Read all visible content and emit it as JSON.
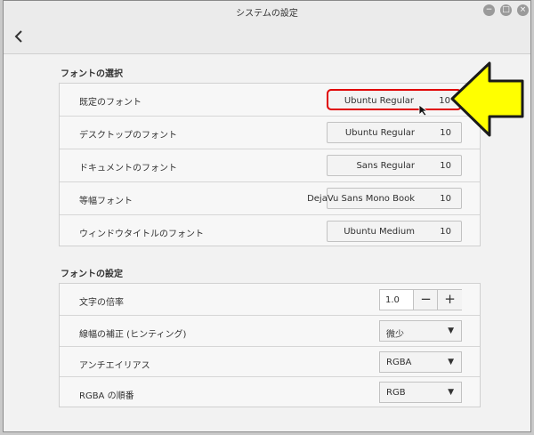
{
  "window": {
    "title": "システムの設定"
  },
  "titlebar_buttons": {
    "minimize": "−",
    "maximize": "□",
    "close": "×"
  },
  "header": {
    "back_icon": "‹"
  },
  "font_selection": {
    "heading": "フォントの選択",
    "rows": [
      {
        "label": "既定のフォント",
        "font": "Ubuntu Regular",
        "size": "10"
      },
      {
        "label": "デスクトップのフォント",
        "font": "Ubuntu Regular",
        "size": "10"
      },
      {
        "label": "ドキュメントのフォント",
        "font": "Sans Regular",
        "size": "10"
      },
      {
        "label": "等幅フォント",
        "font": "DejaVu Sans Mono Book",
        "size": "10"
      },
      {
        "label": "ウィンドウタイトルのフォント",
        "font": "Ubuntu Medium",
        "size": "10"
      }
    ]
  },
  "font_settings": {
    "heading": "フォントの設定",
    "scale": {
      "label": "文字の倍率",
      "value": "1.0",
      "minus": "−",
      "plus": "+"
    },
    "hinting": {
      "label": "線幅の補正 (ヒンティング)",
      "value": "微少"
    },
    "antialias": {
      "label": "アンチエイリアス",
      "value": "RGBA"
    },
    "rgba_order": {
      "label": "RGBA の順番",
      "value": "RGB"
    }
  },
  "annotation": {
    "arrow_color": "#ffff00",
    "highlight_color": "#e00000"
  }
}
